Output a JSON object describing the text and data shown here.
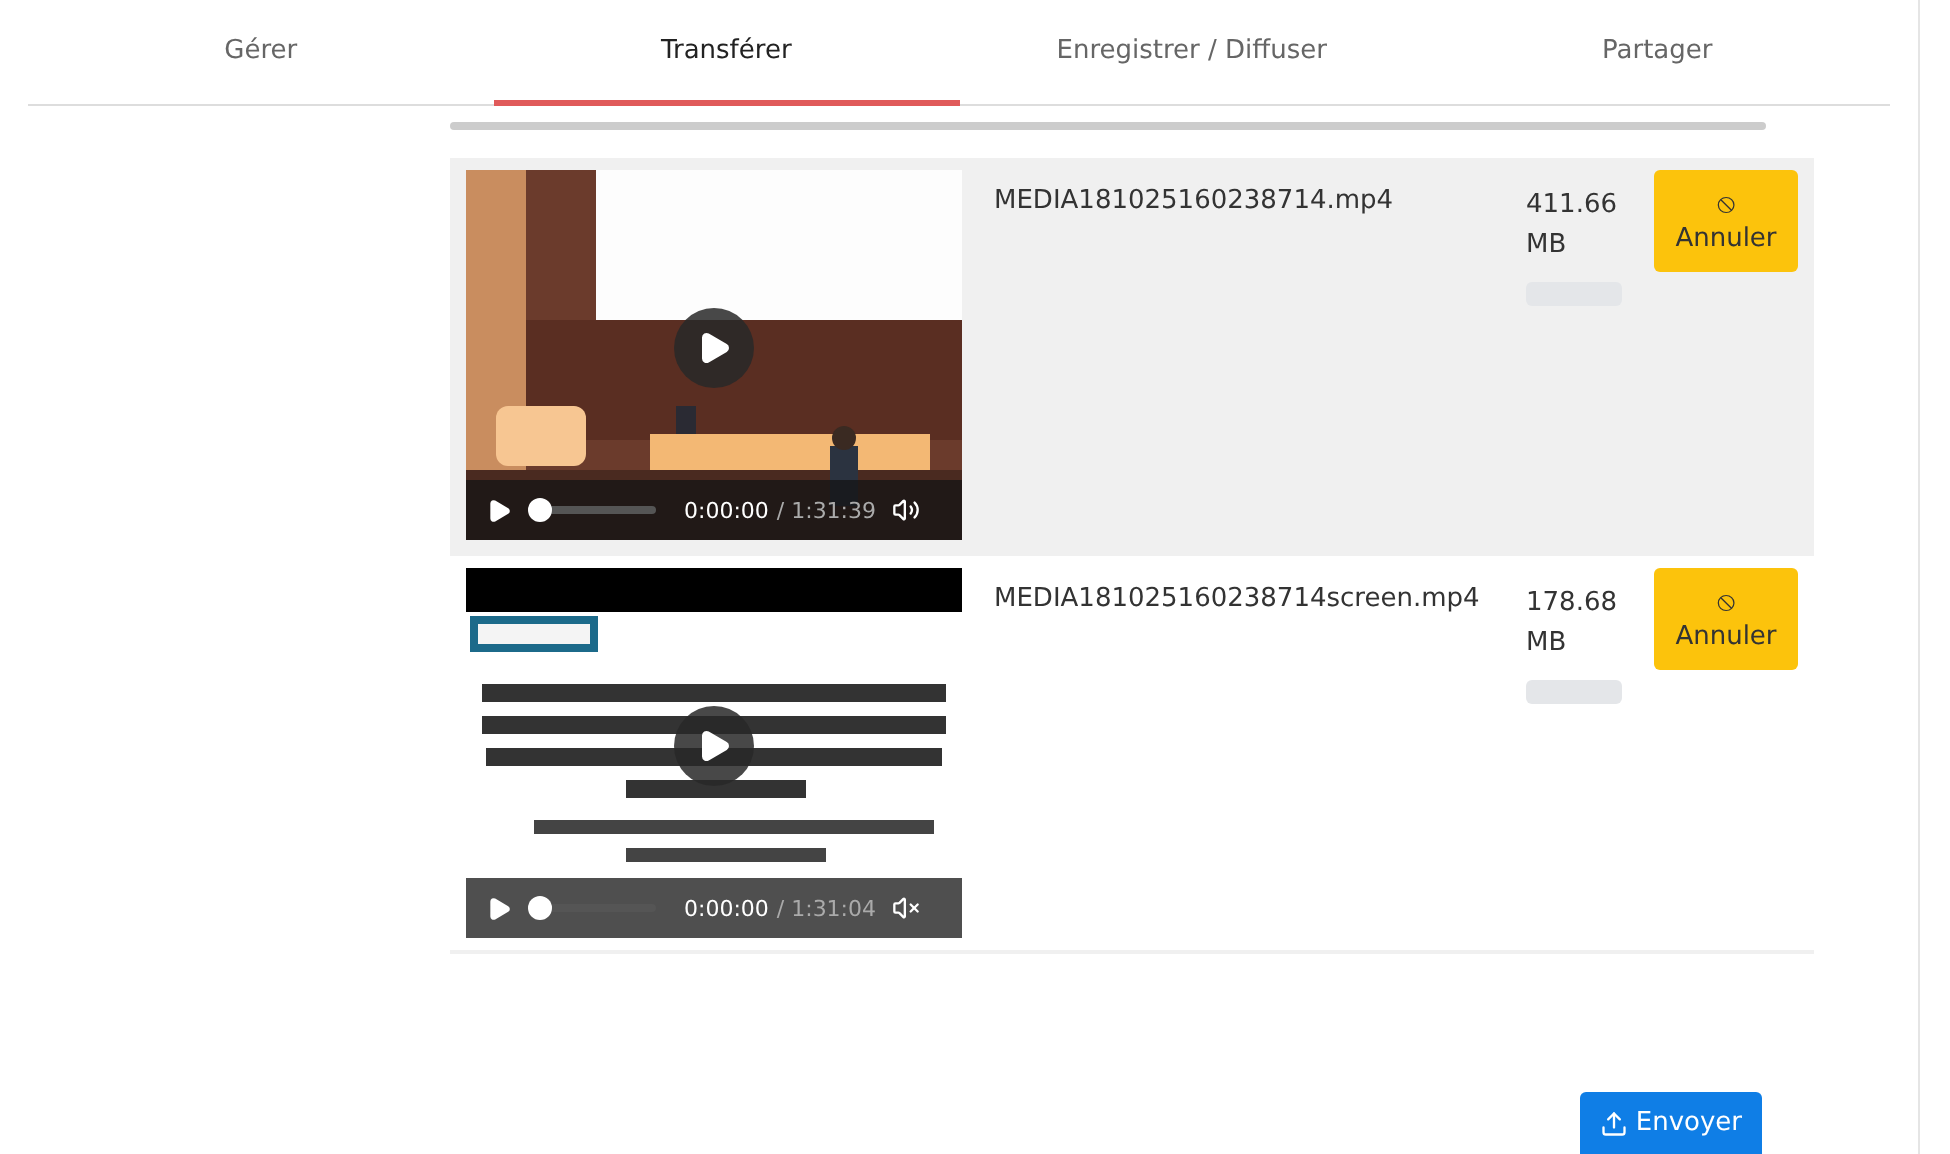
{
  "tabs": [
    {
      "label": "Gérer",
      "selected": false
    },
    {
      "label": "Transférer",
      "selected": true
    },
    {
      "label": "Enregistrer / Diffuser",
      "selected": false
    },
    {
      "label": "Partager",
      "selected": false
    }
  ],
  "files": [
    {
      "shaded": true,
      "video": {
        "time": "0:00:00",
        "duration": "/ 1:31:39",
        "seek": {
          "level": 0
        },
        "muted": false
      },
      "name": "MEDIA181025160238714.mp4",
      "size": "411.66 MB",
      "progress": {
        "level": 0
      },
      "cancel": "Annuler",
      "cancel_icon": "⦸"
    },
    {
      "shaded": false,
      "video": {
        "time": "0:00:00",
        "duration": "/ 1:31:04",
        "seek": {
          "level": 0
        },
        "muted": true
      },
      "name": "MEDIA181025160238714screen.mp4",
      "size": "178.68 MB",
      "progress": {
        "level": 0
      },
      "cancel": "Annuler",
      "cancel_icon": "⦸"
    }
  ],
  "send_button": "Envoyer"
}
